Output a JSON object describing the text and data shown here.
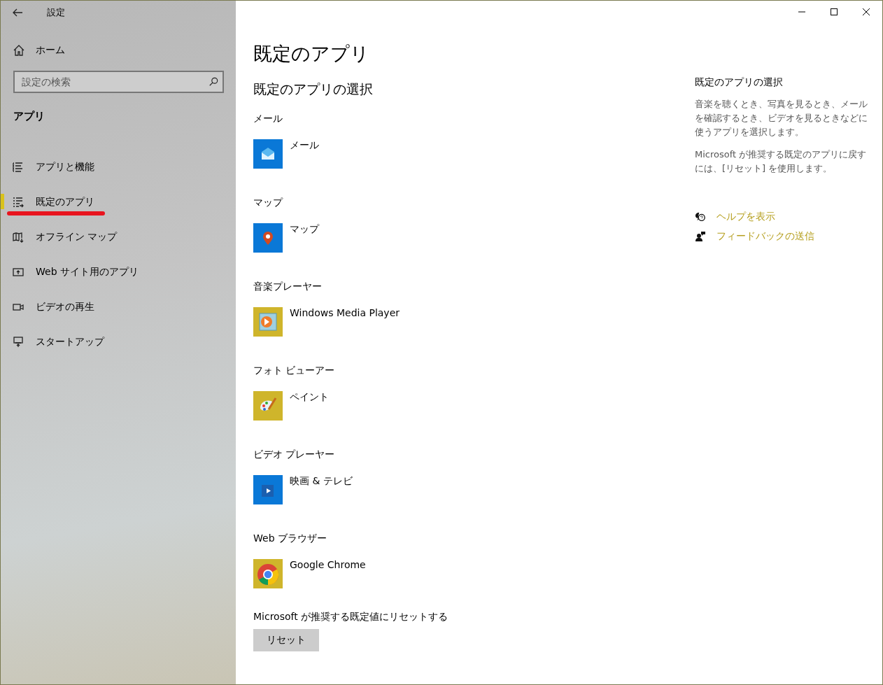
{
  "window": {
    "title": "設定"
  },
  "sidebar": {
    "home": "ホーム",
    "search": {
      "placeholder": "設定の検索"
    },
    "section": "アプリ",
    "items": [
      {
        "label": "アプリと機能",
        "kind": "list",
        "selected": false,
        "annotated": false
      },
      {
        "label": "既定のアプリ",
        "kind": "defaults",
        "selected": true,
        "annotated": true
      },
      {
        "label": "オフライン マップ",
        "kind": "map",
        "selected": false,
        "annotated": false
      },
      {
        "label": "Web サイト用のアプリ",
        "kind": "web",
        "selected": false,
        "annotated": false
      },
      {
        "label": "ビデオの再生",
        "kind": "video",
        "selected": false,
        "annotated": false
      },
      {
        "label": "スタートアップ",
        "kind": "startup",
        "selected": false,
        "annotated": false
      }
    ]
  },
  "main": {
    "title": "既定のアプリ",
    "subtitle": "既定のアプリの選択",
    "categories": [
      {
        "heading": "メール",
        "app": "メール",
        "kind": "mail",
        "color": "#0a78d7"
      },
      {
        "heading": "マップ",
        "app": "マップ",
        "kind": "map",
        "color": "#0a78d7"
      },
      {
        "heading": "音楽プレーヤー",
        "app": "Windows Media Player",
        "kind": "media",
        "color": "#cfb52b"
      },
      {
        "heading": "フォト ビューアー",
        "app": "ペイント",
        "kind": "paint",
        "color": "#cfb52b"
      },
      {
        "heading": "ビデオ プレーヤー",
        "app": "映画 & テレビ",
        "kind": "video",
        "color": "#0a78d7"
      },
      {
        "heading": "Web ブラウザー",
        "app": "Google Chrome",
        "kind": "browser",
        "color": "#cfb52b"
      }
    ],
    "reset_label": "Microsoft が推奨する既定値にリセットする",
    "reset_button": "リセット"
  },
  "aside": {
    "title": "既定のアプリの選択",
    "paragraphs": [
      "音楽を聴くとき、写真を見るとき、メールを確認するとき、ビデオを見るときなどに使うアプリを選択します。",
      "Microsoft が推奨する既定のアプリに戻すには、[リセット] を使用します。"
    ],
    "links": [
      {
        "label": "ヘルプを表示",
        "kind": "help"
      },
      {
        "label": "フィードバックの送信",
        "kind": "feedback"
      }
    ]
  }
}
